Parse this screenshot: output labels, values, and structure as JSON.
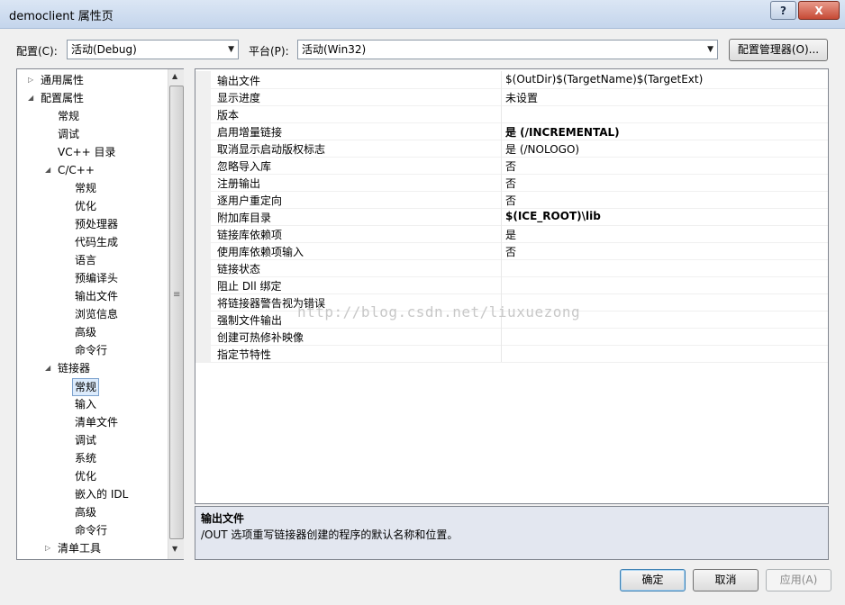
{
  "window": {
    "title": "democlient 属性页",
    "help_glyph": "?",
    "close_glyph": "X"
  },
  "config_row": {
    "config_label": "配置(C):",
    "config_value": "活动(Debug)",
    "platform_label": "平台(P):",
    "platform_value": "活动(Win32)",
    "manager_button": "配置管理器(O)..."
  },
  "tree": {
    "items": [
      {
        "label": "通用属性",
        "expander": "▷"
      },
      {
        "label": "配置属性",
        "expander": "◢"
      },
      {
        "label": "常规"
      },
      {
        "label": "调试"
      },
      {
        "label": "VC++ 目录"
      },
      {
        "label": "C/C++",
        "expander": "◢"
      },
      {
        "label": "常规"
      },
      {
        "label": "优化"
      },
      {
        "label": "预处理器"
      },
      {
        "label": "代码生成"
      },
      {
        "label": "语言"
      },
      {
        "label": "预编译头"
      },
      {
        "label": "输出文件"
      },
      {
        "label": "浏览信息"
      },
      {
        "label": "高级"
      },
      {
        "label": "命令行"
      },
      {
        "label": "链接器",
        "expander": "◢"
      },
      {
        "label": "常规",
        "selected": true
      },
      {
        "label": "输入"
      },
      {
        "label": "清单文件"
      },
      {
        "label": "调试"
      },
      {
        "label": "系统"
      },
      {
        "label": "优化"
      },
      {
        "label": "嵌入的 IDL"
      },
      {
        "label": "高级"
      },
      {
        "label": "命令行"
      },
      {
        "label": "清单工具",
        "expander": "▷"
      }
    ]
  },
  "properties": [
    {
      "name": "输出文件",
      "value": "$(OutDir)$(TargetName)$(TargetExt)",
      "bold": false
    },
    {
      "name": "显示进度",
      "value": "未设置",
      "bold": false
    },
    {
      "name": "版本",
      "value": "",
      "bold": false
    },
    {
      "name": "启用增量链接",
      "value": "是 (/INCREMENTAL)",
      "bold": true
    },
    {
      "name": "取消显示启动版权标志",
      "value": "是 (/NOLOGO)",
      "bold": false
    },
    {
      "name": "忽略导入库",
      "value": "否",
      "bold": false
    },
    {
      "name": "注册输出",
      "value": "否",
      "bold": false
    },
    {
      "name": "逐用户重定向",
      "value": "否",
      "bold": false
    },
    {
      "name": "附加库目录",
      "value": "$(ICE_ROOT)\\lib",
      "bold": true
    },
    {
      "name": "链接库依赖项",
      "value": "是",
      "bold": false
    },
    {
      "name": "使用库依赖项输入",
      "value": "否",
      "bold": false
    },
    {
      "name": "链接状态",
      "value": "",
      "bold": false
    },
    {
      "name": "阻止 Dll 绑定",
      "value": "",
      "bold": false
    },
    {
      "name": "将链接器警告视为错误",
      "value": "",
      "bold": false
    },
    {
      "name": "强制文件输出",
      "value": "",
      "bold": false
    },
    {
      "name": "创建可热修补映像",
      "value": "",
      "bold": false
    },
    {
      "name": "指定节特性",
      "value": "",
      "bold": false
    }
  ],
  "watermark": "http://blog.csdn.net/liuxuezong",
  "description": {
    "title": "输出文件",
    "text": "/OUT 选项重写链接器创建的程序的默认名称和位置。"
  },
  "buttons": {
    "ok": "确定",
    "cancel": "取消",
    "apply": "应用(A)"
  },
  "colors": {
    "selection": "#dcebfc",
    "close_button": "#c64a35",
    "title_bar": "#c4d5ec"
  }
}
